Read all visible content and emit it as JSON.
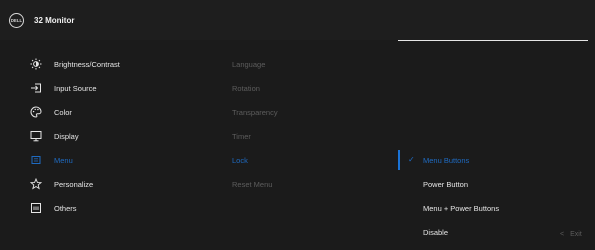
{
  "window": {
    "title": "32 Monitor",
    "logo_text": "DELL"
  },
  "menu": {
    "items": [
      {
        "label": "Brightness/Contrast",
        "icon": "brightness-icon"
      },
      {
        "label": "Input Source",
        "icon": "input-source-icon"
      },
      {
        "label": "Color",
        "icon": "color-palette-icon"
      },
      {
        "label": "Display",
        "icon": "display-monitor-icon"
      },
      {
        "label": "Menu",
        "icon": "menu-icon",
        "selected": true
      },
      {
        "label": "Personalize",
        "icon": "star-icon"
      },
      {
        "label": "Others",
        "icon": "others-icon"
      }
    ]
  },
  "submenu": {
    "items": [
      {
        "label": "Language"
      },
      {
        "label": "Rotation"
      },
      {
        "label": "Transparency"
      },
      {
        "label": "Timer"
      },
      {
        "label": "Lock",
        "selected": true
      },
      {
        "label": "Reset Menu"
      }
    ]
  },
  "options": {
    "items": [
      {
        "label": "Menu Buttons",
        "selected": true
      },
      {
        "label": "Power Button"
      },
      {
        "label": "Menu + Power Buttons"
      },
      {
        "label": "Disable"
      }
    ]
  },
  "footer": {
    "exit_label": "Exit"
  },
  "colors": {
    "accent": "#1f6bc2",
    "background": "#1b1b1b",
    "muted_text": "#5d5d5d",
    "text": "#e6e6e6"
  }
}
